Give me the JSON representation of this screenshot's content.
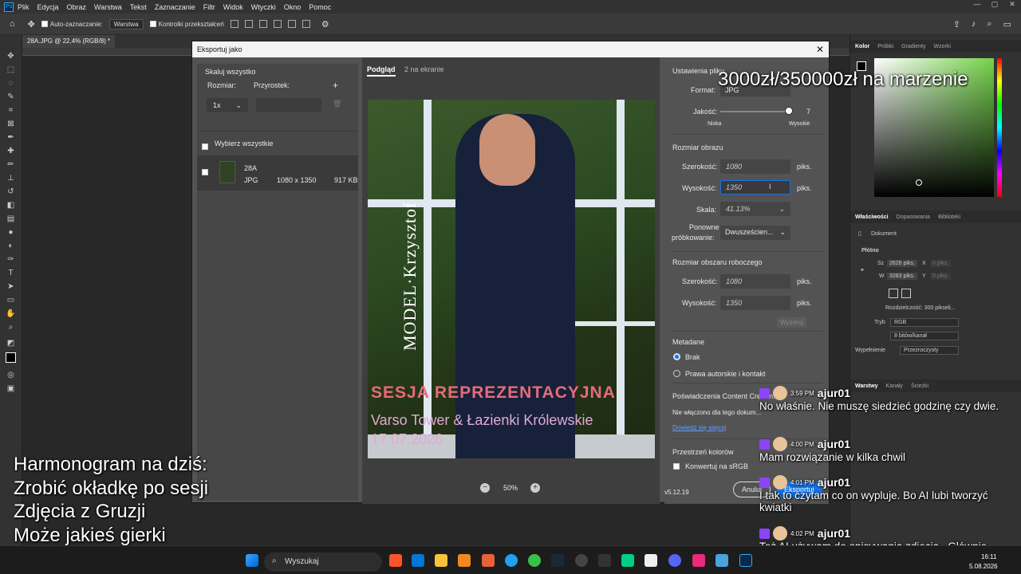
{
  "app": {
    "menu": [
      "Plik",
      "Edycja",
      "Obraz",
      "Warstwa",
      "Tekst",
      "Zaznaczanie",
      "Filtr",
      "Widok",
      "Wtyczki",
      "Okno",
      "Pomoc"
    ],
    "window_controls": [
      "—",
      "▢",
      "✕"
    ],
    "options": {
      "auto_select_label": "Auto-zaznaczanie:",
      "auto_select_value": "Warstwa",
      "transform_label": "Kontrolki przekształceń"
    },
    "doc_tab": "28A.JPG @ 22,4% (RGB/8) *"
  },
  "right_panel": {
    "color_tabs": [
      "Kolor",
      "Próbki",
      "Gradienty",
      "Wzorki"
    ],
    "props_tabs": [
      "Właściwości",
      "Dopasowania",
      "Biblioteki"
    ],
    "document_label": "Dokument",
    "canvas_label": "Płótno",
    "w_label": "Sz",
    "w_value": "2626 piks.",
    "x_label": "X",
    "x_value": "0 piks.",
    "h_label": "W",
    "h_value": "3283 piks.",
    "y_label": "Y",
    "y_value": "0 piks.",
    "resolution": "Rozdzielczość:  300  pikseli...",
    "mode_label": "Tryb",
    "mode_value": "RGB",
    "bits_value": "8 bitów/kanał",
    "fill_label": "Wypełnienie",
    "fill_value": "Przezroczysty",
    "layers_tabs": [
      "Warstwy",
      "Kanały",
      "Ścieżki"
    ]
  },
  "dialog": {
    "title": "Eksportuj jako",
    "close": "✕",
    "left": {
      "scale_all": "Skaluj wszystko",
      "size_label": "Rozmiar:",
      "suffix_label": "Przyrostek:",
      "size_value": "1x",
      "select_all": "Wybierz wszystkie",
      "file": {
        "name": "28A",
        "format": "JPG",
        "dims": "1080 x 1350",
        "size": "917 KB"
      }
    },
    "mid": {
      "tabs": [
        "Podgląd",
        "2 na ekranie"
      ],
      "zoom": "50%",
      "poster": {
        "vertical": "MODEL·Krzysztof",
        "sesja": "SESJA REPREZENTACYJNA",
        "venue": "Varso Tower & Łazienki Królewskie",
        "date": "17.07.2026"
      }
    },
    "right": {
      "file_settings": "Ustawienia pliku",
      "format_label": "Format:",
      "format_value": "JPG",
      "quality_label": "Jakość:",
      "quality_value": "7",
      "quality_low": "Niska",
      "quality_high": "Wysokie",
      "image_size": "Rozmiar obrazu",
      "width_label": "Szerokość:",
      "width_value": "1080",
      "height_label": "Wysokość:",
      "height_value": "1350",
      "unit": "piks.",
      "scale_label": "Skala:",
      "scale_value": "41.13%",
      "resample_label1": "Ponowne",
      "resample_label2": "próbkowanie:",
      "resample_value": "Dwusześcien...",
      "canvas_size": "Rozmiar obszaru roboczego",
      "cwidth_value": "1080",
      "cheight_value": "1350",
      "reset": "Wyzeruj",
      "metadata": "Metadane",
      "meta_none": "Brak",
      "meta_copy": "Prawa autorskie i kontakt",
      "content_creds": "Poświadczenia Content Creden...",
      "cc_text": "Nie włączono dla tego dokum...",
      "learn_more": "Dowiedz się więcej",
      "color_space": "Przestrzeń kolorów",
      "convert_srgb": "Konwertuj na sRGB",
      "version": "v5.12.19",
      "cancel": "Anuluj",
      "export": "Eksportuj"
    }
  },
  "overlay": {
    "goal": "3000zł/350000zł na marzenie",
    "harmonogram": [
      "Harmonogram na dziś:",
      "Zrobić okładkę po sesji",
      "Zdjęcia z Gruzji",
      "Może jakieś gierki"
    ]
  },
  "chat": [
    {
      "time": "3:59 PM",
      "user": "ajur01",
      "text": "No właśnie. Nie muszę siedzieć godzinę czy dwie."
    },
    {
      "time": "4:00 PM",
      "user": "ajur01",
      "text": "Mam rozwiązanie w kilka chwil"
    },
    {
      "time": "4:01 PM",
      "user": "ajur01",
      "text": "I tak to czytam co on wypluje. Bo AI lubi tworzyć kwiatki"
    },
    {
      "time": "4:02 PM",
      "user": "ajur01",
      "text": "Też AI używam do opisywania zdjęcia . Głównie chodzi o ubranie."
    }
  ],
  "taskbar": {
    "search": "Wyszukaj",
    "date": "5.08.2026",
    "time": "16:11"
  },
  "colors": {
    "accent_blue": "#1473e6",
    "twitch_purple": "#8c44f7"
  }
}
